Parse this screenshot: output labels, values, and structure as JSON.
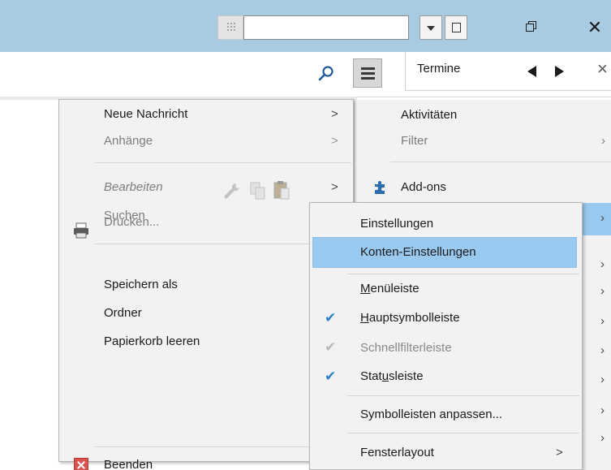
{
  "window": {
    "quick_filter_value": "",
    "restore_glyph_name": "restore-icon",
    "close_glyph": "✕"
  },
  "toolbar": {
    "search_icon": "search-icon",
    "menu_icon": "hamburger-menu-icon"
  },
  "today_pane": {
    "tab_label": "Termine",
    "prev_icon": "triangle-left-icon",
    "next_icon": "triangle-right-icon",
    "close_glyph": "×"
  },
  "app_menu": {
    "items": [
      {
        "label": "Aktivitäten",
        "submenu": false,
        "disabled": false
      },
      {
        "label": "Filter",
        "submenu": true,
        "disabled": true
      },
      {
        "label": "Add-ons",
        "submenu": false,
        "disabled": false
      }
    ],
    "arrow": "›"
  },
  "file_menu": {
    "new_message": "Neue Nachricht",
    "attachments": "Anhänge",
    "edit": "Bearbeiten",
    "find": "Suchen",
    "print": "Drucken...",
    "save_as": "Speichern als",
    "folder": "Ordner",
    "empty_trash": "Papierkorb leeren",
    "quit": "Beenden",
    "arrow": ">"
  },
  "view_menu": {
    "preferences": "Einstellungen",
    "account_settings": "Konten-Einstellungen",
    "menubar_pre": "",
    "menubar_u": "M",
    "menubar_post": "enüleiste",
    "main_toolbar_u": "H",
    "main_toolbar_post": "auptsymbolleiste",
    "quick_filter_bar": "Schnellfilterleiste",
    "status_bar_pre": "Stat",
    "status_bar_u": "u",
    "status_bar_post": "sleiste",
    "customize": "Symbolleisten anpassen...",
    "layout": "Fensterlayout",
    "check": "✔",
    "arrow": ">"
  },
  "colors": {
    "titlebar": "#a9cbe2",
    "highlight": "#99c9ef",
    "check": "#2d7ec6"
  }
}
